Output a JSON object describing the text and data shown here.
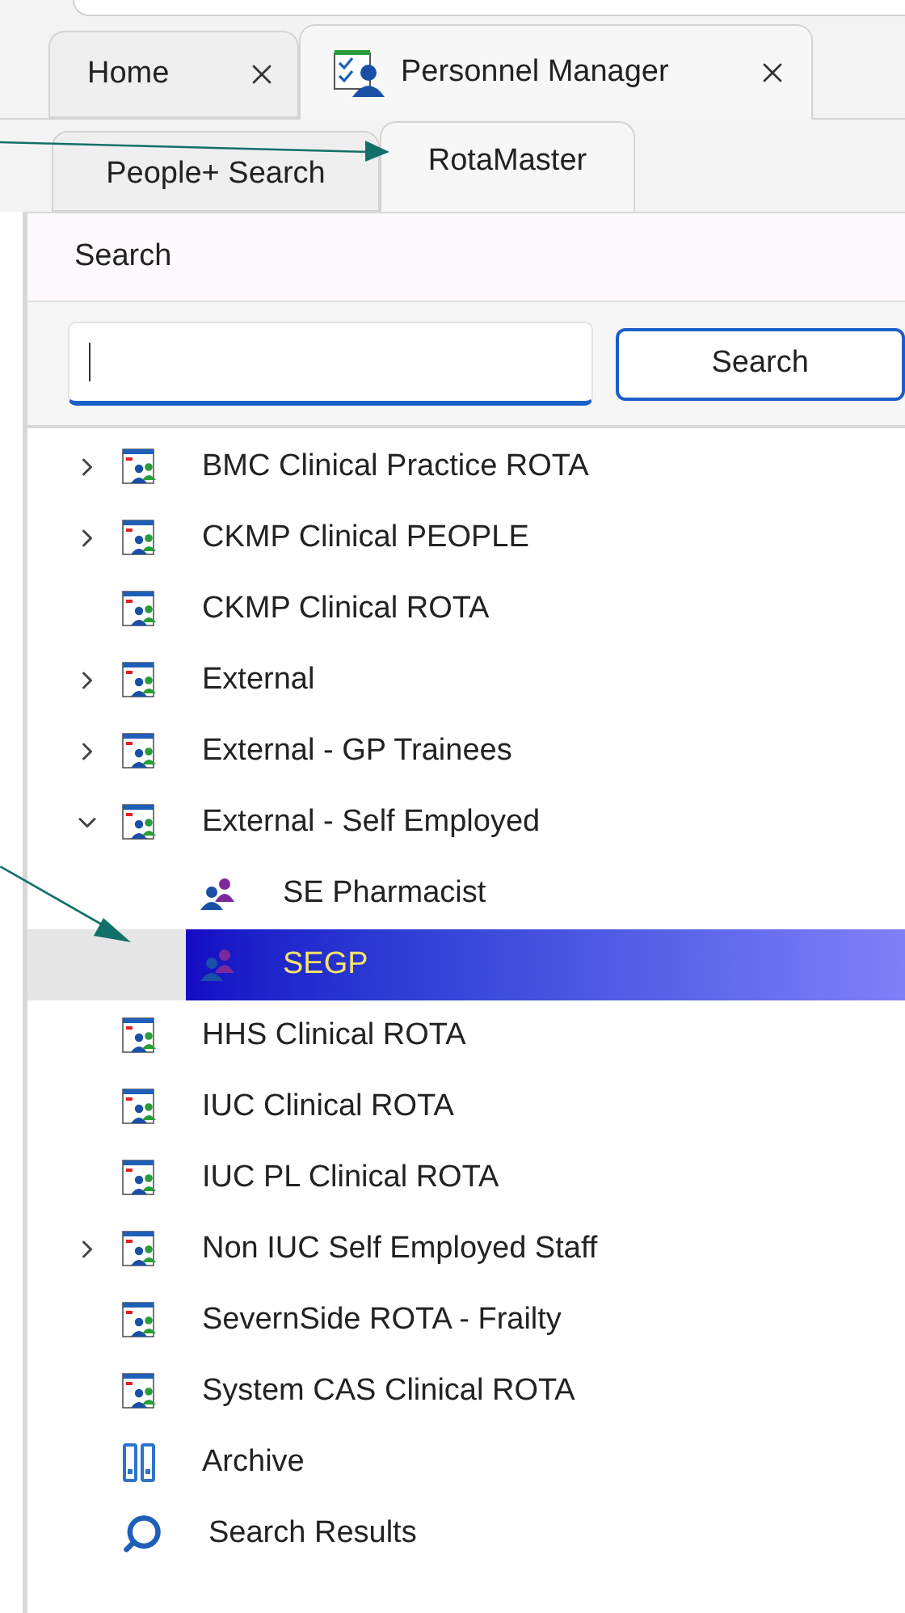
{
  "tabs": [
    {
      "label": "Home",
      "selected": false
    },
    {
      "label": "Personnel Manager",
      "selected": true
    }
  ],
  "subtabs": [
    {
      "label": "People+ Search",
      "selected": false
    },
    {
      "label": "RotaMaster",
      "selected": true
    }
  ],
  "search": {
    "title": "Search",
    "button": "Search"
  },
  "tree": [
    {
      "label": "BMC Clinical Practice ROTA",
      "kind": "rota",
      "expanded": false,
      "selected": false
    },
    {
      "label": "CKMP Clinical PEOPLE",
      "kind": "rota",
      "expanded": false,
      "selected": false
    },
    {
      "label": "CKMP Clinical ROTA",
      "kind": "rota",
      "selected": false
    },
    {
      "label": "External",
      "kind": "rota",
      "expanded": false,
      "selected": false
    },
    {
      "label": "External - GP Trainees",
      "kind": "rota",
      "expanded": false,
      "selected": false
    },
    {
      "label": "External - Self Employed",
      "kind": "rota",
      "expanded": true,
      "selected": false,
      "children": [
        {
          "label": "SE Pharmacist",
          "kind": "group",
          "selected": false
        },
        {
          "label": "SEGP",
          "kind": "group",
          "selected": true
        }
      ]
    },
    {
      "label": "HHS Clinical ROTA",
      "kind": "rota",
      "selected": false
    },
    {
      "label": "IUC Clinical ROTA",
      "kind": "rota",
      "selected": false
    },
    {
      "label": "IUC PL Clinical ROTA",
      "kind": "rota",
      "selected": false
    },
    {
      "label": "Non IUC  Self Employed Staff",
      "kind": "rota",
      "expanded": false,
      "selected": false
    },
    {
      "label": "SevernSide ROTA - Frailty",
      "kind": "rota",
      "selected": false
    },
    {
      "label": "System CAS Clinical ROTA",
      "kind": "rota",
      "selected": false
    },
    {
      "label": "Archive",
      "kind": "archive",
      "selected": false
    },
    {
      "label": "Search Results",
      "kind": "search",
      "selected": false
    }
  ]
}
